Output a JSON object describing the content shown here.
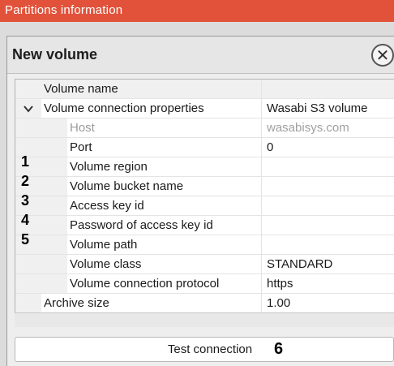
{
  "window": {
    "title": "Partitions information"
  },
  "dialog": {
    "title": "New volume",
    "close_icon": "close-icon"
  },
  "grid": {
    "rows": [
      {
        "name": "Volume name",
        "value": "",
        "level": 0,
        "muted": false,
        "expandable": false
      },
      {
        "name": "Volume connection properties",
        "value": "Wasabi S3 volume",
        "level": 0,
        "muted": false,
        "expandable": true,
        "expanded": true
      },
      {
        "name": "Host",
        "value": "wasabisys.com",
        "level": 1,
        "muted": true,
        "expandable": false
      },
      {
        "name": "Port",
        "value": "0",
        "level": 1,
        "muted": false,
        "expandable": false
      },
      {
        "name": "Volume region",
        "value": "",
        "level": 1,
        "muted": false,
        "expandable": false,
        "marker": "1"
      },
      {
        "name": "Volume bucket name",
        "value": "",
        "level": 1,
        "muted": false,
        "expandable": false,
        "marker": "2"
      },
      {
        "name": "Access key id",
        "value": "",
        "level": 1,
        "muted": false,
        "expandable": false,
        "marker": "3"
      },
      {
        "name": "Password of access key id",
        "value": "",
        "level": 1,
        "muted": false,
        "expandable": false,
        "marker": "4"
      },
      {
        "name": "Volume path",
        "value": "",
        "level": 1,
        "muted": false,
        "expandable": false,
        "marker": "5"
      },
      {
        "name": "Volume class",
        "value": "STANDARD",
        "level": 1,
        "muted": false,
        "expandable": false
      },
      {
        "name": "Volume connection protocol",
        "value": "https",
        "level": 1,
        "muted": false,
        "expandable": false
      },
      {
        "name": "Archive size",
        "value": "1.00",
        "level": 0,
        "muted": false,
        "expandable": false
      }
    ]
  },
  "actions": {
    "test_connection_label": "Test connection",
    "test_connection_marker": "6"
  },
  "colors": {
    "titlebar": "#e2523a",
    "muted_text": "#9a9a9a"
  }
}
